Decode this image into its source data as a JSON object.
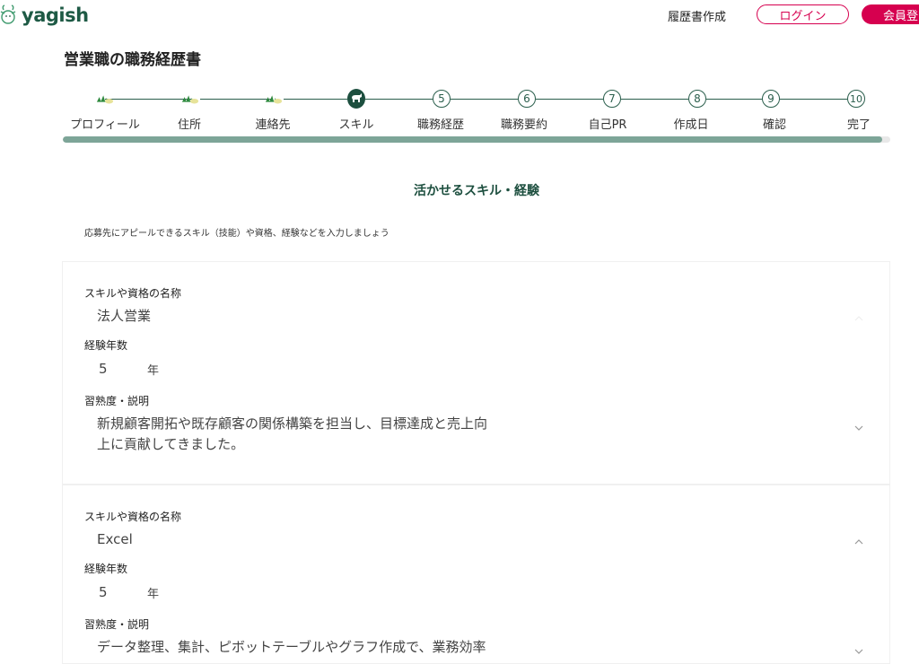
{
  "header": {
    "logo_text": "yagish",
    "nav_resume": "履歴書作成",
    "login_label": "ログイン",
    "signup_label": "会員登"
  },
  "page_title": "営業職の職務経歴書",
  "stepper": {
    "progress": 0.99,
    "steps": [
      {
        "label": "プロフィール",
        "state": "done"
      },
      {
        "label": "住所",
        "state": "done"
      },
      {
        "label": "連絡先",
        "state": "done"
      },
      {
        "label": "スキル",
        "state": "current"
      },
      {
        "label": "職務経歴",
        "number": "5",
        "state": "todo"
      },
      {
        "label": "職務要約",
        "number": "6",
        "state": "todo"
      },
      {
        "label": "自己PR",
        "number": "7",
        "state": "todo"
      },
      {
        "label": "作成日",
        "number": "8",
        "state": "todo"
      },
      {
        "label": "確認",
        "number": "9",
        "state": "todo"
      },
      {
        "label": "完了",
        "number": "10",
        "state": "todo"
      }
    ]
  },
  "section_title": "活かせるスキル・経験",
  "intro": "応募先にアピールできるスキル（技能）や資格、経験などを入力しましょう",
  "skills": [
    {
      "name_label": "スキルや資格の名称",
      "name_value": "法人営業",
      "years_label": "経験年数",
      "years_value": "5",
      "years_unit": "年",
      "desc_label": "習熟度・説明",
      "desc_line1": "新規顧客開拓や既存顧客の関係構築を担当し、目標達成と売上向",
      "desc_line2": "上に貢献してきました。"
    },
    {
      "name_label": "スキルや資格の名称",
      "name_value": "Excel",
      "years_label": "経験年数",
      "years_value": "5",
      "years_unit": "年",
      "desc_label": "習熟度・説明",
      "desc_line1": "データ整理、集計、ピボットテーブルやグラフ作成で、業務効率",
      "desc_line2": ""
    }
  ],
  "colors": {
    "brand_green": "#1d4f3f",
    "accent_pink": "#d6004f",
    "progress_fill": "#7da598"
  }
}
